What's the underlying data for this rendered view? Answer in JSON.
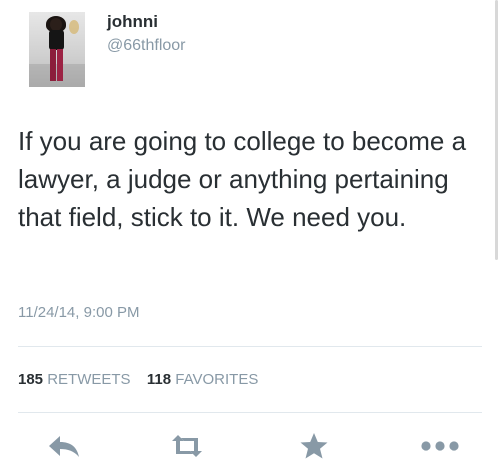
{
  "user": {
    "name": "johnni",
    "handle": "@66thfloor"
  },
  "tweet": {
    "text": "If you are going to college to become a lawyer, a judge or anything pertaining that field, stick to it. We need you.",
    "timestamp": "11/24/14, 9:00 PM"
  },
  "stats": {
    "retweets_count": "185",
    "retweets_label": "RETWEETS",
    "favorites_count": "118",
    "favorites_label": "FAVORITES"
  },
  "actions": {
    "reply_icon": "reply-icon",
    "retweet_icon": "retweet-icon",
    "favorite_icon": "star-icon",
    "more_icon": "more-icon"
  },
  "colors": {
    "text": "#292f33",
    "muted": "#8899a6",
    "icon": "#8899a6",
    "divider": "#e1e8ed"
  }
}
